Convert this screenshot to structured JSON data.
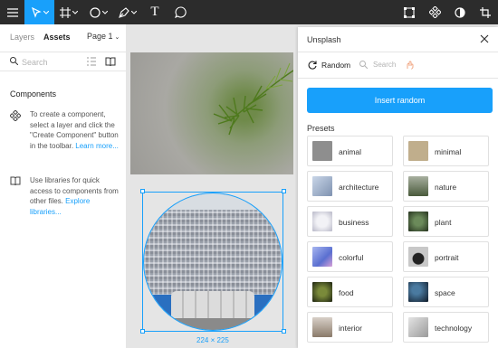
{
  "toolbar": {
    "tools": [
      "menu-icon",
      "move-tool-icon",
      "frame-tool-icon",
      "shape-tool-icon",
      "pen-tool-icon",
      "text-tool-icon",
      "comment-tool-icon"
    ],
    "right_tools": [
      "component-icon",
      "create-component-icon",
      "mask-icon",
      "crop-icon"
    ],
    "text_tool_glyph": "T"
  },
  "left_panel": {
    "tabs": [
      "Layers",
      "Assets"
    ],
    "active_tab": "Assets",
    "page_select": "Page 1",
    "search_placeholder": "Search",
    "components_title": "Components",
    "hint_create": {
      "text": "To create a component, select a layer and click the \"Create Component\" button in the toolbar.",
      "link": "Learn more..."
    },
    "hint_libraries": {
      "text": "Use libraries for quick access to components from other files.",
      "link": "Explore libraries..."
    }
  },
  "canvas": {
    "selection_dims": "224 × 225"
  },
  "plugin": {
    "title": "Unsplash",
    "random_tab": "Random",
    "search_placeholder": "Search",
    "insert_button": "Insert random",
    "presets_label": "Presets",
    "presets": [
      {
        "label": "animal",
        "color": "#9a9a9a"
      },
      {
        "label": "minimal",
        "color": "#b9a98a"
      },
      {
        "label": "architecture",
        "color": "#8fa3c0"
      },
      {
        "label": "nature",
        "color": "#5b6a4a"
      },
      {
        "label": "business",
        "color": "#c9c9d6"
      },
      {
        "label": "plant",
        "color": "#3f5a3a"
      },
      {
        "label": "colorful",
        "color": "#7a8fd6"
      },
      {
        "label": "portrait",
        "color": "#3a3a3a"
      },
      {
        "label": "food",
        "color": "#2c3a1e"
      },
      {
        "label": "space",
        "color": "#2a4a6a"
      },
      {
        "label": "interior",
        "color": "#8a7a6a"
      },
      {
        "label": "technology",
        "color": "#b5b5b5"
      }
    ],
    "accent": "#18a0fb"
  }
}
